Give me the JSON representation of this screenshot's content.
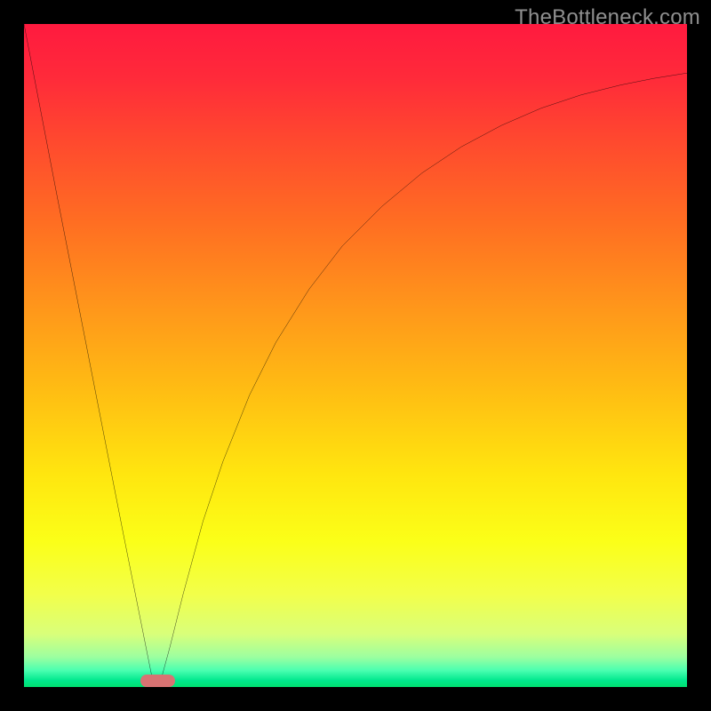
{
  "watermark": "TheBottleneck.com",
  "chart_data": {
    "type": "line",
    "title": "",
    "xlabel": "",
    "ylabel": "",
    "xlim": [
      0,
      100
    ],
    "ylim": [
      0,
      100
    ],
    "gradient_stops": [
      {
        "offset": 0.0,
        "color": "#ff1a3f"
      },
      {
        "offset": 0.08,
        "color": "#ff2a3a"
      },
      {
        "offset": 0.18,
        "color": "#ff4a2e"
      },
      {
        "offset": 0.3,
        "color": "#ff6e22"
      },
      {
        "offset": 0.42,
        "color": "#ff941b"
      },
      {
        "offset": 0.55,
        "color": "#ffbc13"
      },
      {
        "offset": 0.68,
        "color": "#ffe60f"
      },
      {
        "offset": 0.78,
        "color": "#fbff18"
      },
      {
        "offset": 0.86,
        "color": "#f2ff4a"
      },
      {
        "offset": 0.92,
        "color": "#d9ff7a"
      },
      {
        "offset": 0.955,
        "color": "#9cffa0"
      },
      {
        "offset": 0.975,
        "color": "#4affb0"
      },
      {
        "offset": 0.99,
        "color": "#00e88e"
      },
      {
        "offset": 1.0,
        "color": "#00e070"
      }
    ],
    "series": [
      {
        "name": "bottleneck-curve",
        "x": [
          0,
          5,
          10,
          15,
          19.5,
          20.0,
          20.5,
          22,
          24,
          27,
          30,
          34,
          38,
          43,
          48,
          54,
          60,
          66,
          72,
          78,
          84,
          90,
          95,
          100
        ],
        "y": [
          100,
          74,
          48.5,
          23,
          0.5,
          0,
          0.5,
          6,
          14,
          25,
          34,
          44,
          52,
          60,
          66.5,
          72.5,
          77.5,
          81.5,
          84.7,
          87.3,
          89.3,
          90.8,
          91.8,
          92.6
        ]
      }
    ],
    "marker": {
      "name": "min-marker",
      "x_center": 20.2,
      "width_pct": 5.2,
      "color": "#d87373"
    }
  }
}
